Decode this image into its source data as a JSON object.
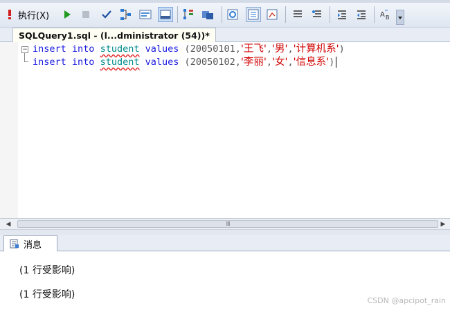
{
  "toolbar": {
    "execute_icon": "exclamation-icon",
    "execute_label": "执行(X)",
    "run_icon": "play-icon",
    "stop_icon": "stop-icon",
    "parse_icon": "checkmark-icon",
    "display_plan_icon": "query-plan-icon",
    "query_options_icon": "query-options-icon",
    "results_icon": "results-to-grid-icon",
    "text_results_icon": "results-to-text-icon",
    "file_results_icon": "results-to-file-icon",
    "comment_icon": "comment-lines-icon",
    "uncomment_icon": "uncomment-lines-icon",
    "indent_icon": "indent-icon",
    "outdent_icon": "outdent-icon",
    "specify_values_icon": "specify-values-icon",
    "overflow_icon": "chevron-down-icon"
  },
  "tab": {
    "title": "SQLQuery1.sql - (l...dministrator (54))*"
  },
  "editor": {
    "lines": [
      {
        "kw_insert": "insert",
        "kw_into": "into",
        "table": "student",
        "kw_values": "values",
        "open": "(",
        "id": "20050101,",
        "name": "'王飞'",
        "sep1": ",",
        "gender": "'男'",
        "sep2": ",",
        "dept": "'计算机系'",
        "close": ")"
      },
      {
        "kw_insert": "insert",
        "kw_into": "into",
        "table": "student",
        "kw_values": "values",
        "open": "(",
        "id": "20050102,",
        "name": "'李丽'",
        "sep1": ",",
        "gender": "'女'",
        "sep2": ",",
        "dept": "'信息系'",
        "close": ")"
      }
    ]
  },
  "scrollbar": {
    "grip": "III"
  },
  "results": {
    "tab_label": "消息",
    "messages": [
      "(1 行受影响)",
      "(1 行受影响)"
    ]
  },
  "watermark": "CSDN @apcipot_rain"
}
